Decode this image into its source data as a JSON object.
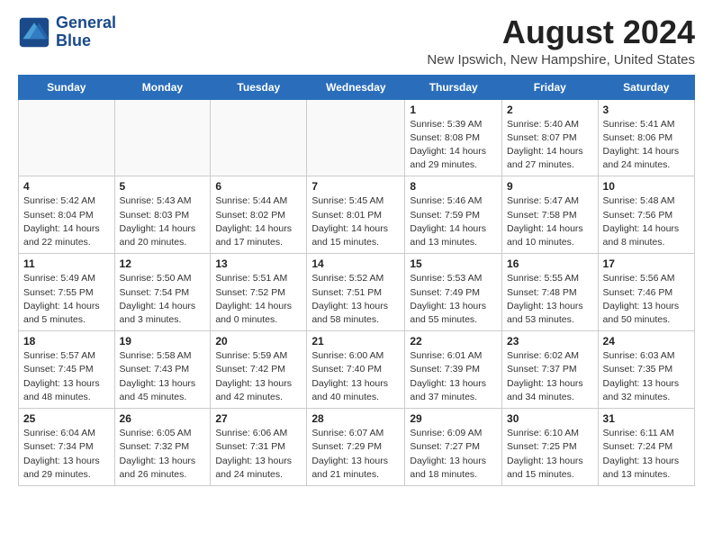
{
  "logo": {
    "name": "GeneralBlue",
    "line1": "General",
    "line2": "Blue"
  },
  "title": "August 2024",
  "subtitle": "New Ipswich, New Hampshire, United States",
  "weekdays": [
    "Sunday",
    "Monday",
    "Tuesday",
    "Wednesday",
    "Thursday",
    "Friday",
    "Saturday"
  ],
  "weeks": [
    [
      {
        "day": "",
        "info": ""
      },
      {
        "day": "",
        "info": ""
      },
      {
        "day": "",
        "info": ""
      },
      {
        "day": "",
        "info": ""
      },
      {
        "day": "1",
        "info": "Sunrise: 5:39 AM\nSunset: 8:08 PM\nDaylight: 14 hours\nand 29 minutes."
      },
      {
        "day": "2",
        "info": "Sunrise: 5:40 AM\nSunset: 8:07 PM\nDaylight: 14 hours\nand 27 minutes."
      },
      {
        "day": "3",
        "info": "Sunrise: 5:41 AM\nSunset: 8:06 PM\nDaylight: 14 hours\nand 24 minutes."
      }
    ],
    [
      {
        "day": "4",
        "info": "Sunrise: 5:42 AM\nSunset: 8:04 PM\nDaylight: 14 hours\nand 22 minutes."
      },
      {
        "day": "5",
        "info": "Sunrise: 5:43 AM\nSunset: 8:03 PM\nDaylight: 14 hours\nand 20 minutes."
      },
      {
        "day": "6",
        "info": "Sunrise: 5:44 AM\nSunset: 8:02 PM\nDaylight: 14 hours\nand 17 minutes."
      },
      {
        "day": "7",
        "info": "Sunrise: 5:45 AM\nSunset: 8:01 PM\nDaylight: 14 hours\nand 15 minutes."
      },
      {
        "day": "8",
        "info": "Sunrise: 5:46 AM\nSunset: 7:59 PM\nDaylight: 14 hours\nand 13 minutes."
      },
      {
        "day": "9",
        "info": "Sunrise: 5:47 AM\nSunset: 7:58 PM\nDaylight: 14 hours\nand 10 minutes."
      },
      {
        "day": "10",
        "info": "Sunrise: 5:48 AM\nSunset: 7:56 PM\nDaylight: 14 hours\nand 8 minutes."
      }
    ],
    [
      {
        "day": "11",
        "info": "Sunrise: 5:49 AM\nSunset: 7:55 PM\nDaylight: 14 hours\nand 5 minutes."
      },
      {
        "day": "12",
        "info": "Sunrise: 5:50 AM\nSunset: 7:54 PM\nDaylight: 14 hours\nand 3 minutes."
      },
      {
        "day": "13",
        "info": "Sunrise: 5:51 AM\nSunset: 7:52 PM\nDaylight: 14 hours\nand 0 minutes."
      },
      {
        "day": "14",
        "info": "Sunrise: 5:52 AM\nSunset: 7:51 PM\nDaylight: 13 hours\nand 58 minutes."
      },
      {
        "day": "15",
        "info": "Sunrise: 5:53 AM\nSunset: 7:49 PM\nDaylight: 13 hours\nand 55 minutes."
      },
      {
        "day": "16",
        "info": "Sunrise: 5:55 AM\nSunset: 7:48 PM\nDaylight: 13 hours\nand 53 minutes."
      },
      {
        "day": "17",
        "info": "Sunrise: 5:56 AM\nSunset: 7:46 PM\nDaylight: 13 hours\nand 50 minutes."
      }
    ],
    [
      {
        "day": "18",
        "info": "Sunrise: 5:57 AM\nSunset: 7:45 PM\nDaylight: 13 hours\nand 48 minutes."
      },
      {
        "day": "19",
        "info": "Sunrise: 5:58 AM\nSunset: 7:43 PM\nDaylight: 13 hours\nand 45 minutes."
      },
      {
        "day": "20",
        "info": "Sunrise: 5:59 AM\nSunset: 7:42 PM\nDaylight: 13 hours\nand 42 minutes."
      },
      {
        "day": "21",
        "info": "Sunrise: 6:00 AM\nSunset: 7:40 PM\nDaylight: 13 hours\nand 40 minutes."
      },
      {
        "day": "22",
        "info": "Sunrise: 6:01 AM\nSunset: 7:39 PM\nDaylight: 13 hours\nand 37 minutes."
      },
      {
        "day": "23",
        "info": "Sunrise: 6:02 AM\nSunset: 7:37 PM\nDaylight: 13 hours\nand 34 minutes."
      },
      {
        "day": "24",
        "info": "Sunrise: 6:03 AM\nSunset: 7:35 PM\nDaylight: 13 hours\nand 32 minutes."
      }
    ],
    [
      {
        "day": "25",
        "info": "Sunrise: 6:04 AM\nSunset: 7:34 PM\nDaylight: 13 hours\nand 29 minutes."
      },
      {
        "day": "26",
        "info": "Sunrise: 6:05 AM\nSunset: 7:32 PM\nDaylight: 13 hours\nand 26 minutes."
      },
      {
        "day": "27",
        "info": "Sunrise: 6:06 AM\nSunset: 7:31 PM\nDaylight: 13 hours\nand 24 minutes."
      },
      {
        "day": "28",
        "info": "Sunrise: 6:07 AM\nSunset: 7:29 PM\nDaylight: 13 hours\nand 21 minutes."
      },
      {
        "day": "29",
        "info": "Sunrise: 6:09 AM\nSunset: 7:27 PM\nDaylight: 13 hours\nand 18 minutes."
      },
      {
        "day": "30",
        "info": "Sunrise: 6:10 AM\nSunset: 7:25 PM\nDaylight: 13 hours\nand 15 minutes."
      },
      {
        "day": "31",
        "info": "Sunrise: 6:11 AM\nSunset: 7:24 PM\nDaylight: 13 hours\nand 13 minutes."
      }
    ]
  ]
}
